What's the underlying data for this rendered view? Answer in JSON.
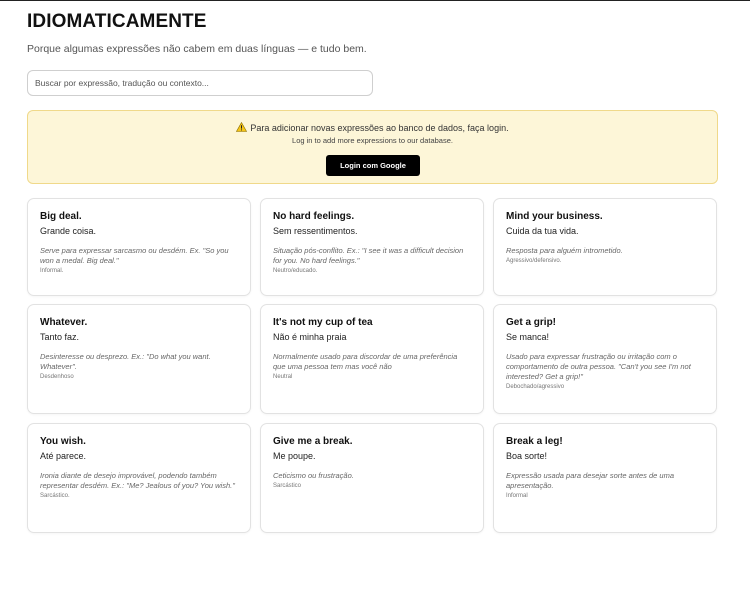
{
  "header": {
    "title": "IDIOMATICAMENTE",
    "subtitle": "Porque algumas expressões não cabem em duas línguas — e tudo bem."
  },
  "search": {
    "placeholder": "Buscar por expressão, tradução ou contexto..."
  },
  "notice": {
    "icon": "warning-icon",
    "line1": "Para adicionar novas expressões ao banco de dados, faça login.",
    "line2": "Log in to add more expressions to our database.",
    "login_label": "Login com Google",
    "bg_color": "#fdf6d8",
    "border_color": "#f0d98a"
  },
  "cards": [
    {
      "en": "Big deal.",
      "pt": "Grande coisa.",
      "desc": "Serve para expressar sarcasmo ou desdém. Ex. \"So you won a medal. Big deal.\"",
      "tone": "Informal."
    },
    {
      "en": "No hard feelings.",
      "pt": "Sem ressentimentos.",
      "desc": "Situação pós-conflito. Ex.: \"I see it was a difficult decision for you. No hard feelings.\"",
      "tone": "Neutro/educado."
    },
    {
      "en": "Mind your business.",
      "pt": "Cuida da tua vida.",
      "desc": "Resposta para alguém intrometido.",
      "tone": "Agressivo/defensivo."
    },
    {
      "en": "Whatever.",
      "pt": "Tanto faz.",
      "desc": "Desinteresse ou desprezo. Ex.: \"Do what you want. Whatever\".",
      "tone": "Desdenhoso"
    },
    {
      "en": "It's not my cup of tea",
      "pt": "Não é minha praia",
      "desc": "Normalmente usado para discordar de uma preferência que uma pessoa tem mas você não",
      "tone": "Neutral"
    },
    {
      "en": "Get a grip!",
      "pt": "Se manca!",
      "desc": "Usado para expressar frustração ou irritação com o comportamento de outra pessoa. \"Can't you see I'm not interested? Get a grip!\"",
      "tone": "Debochado/agressivo"
    },
    {
      "en": "You wish.",
      "pt": "Até parece.",
      "desc": "Ironia diante de desejo improvável, podendo também representar desdém. Ex.: \"Me? Jealous of you? You wish.\"",
      "tone": "Sarcástico."
    },
    {
      "en": "Give me a break.",
      "pt": "Me poupe.",
      "desc": "Ceticismo ou frustração.",
      "tone": "Sarcástico"
    },
    {
      "en": "Break a leg!",
      "pt": "Boa sorte!",
      "desc": "Expressão usada para desejar sorte antes de uma apresentação.",
      "tone": "Informal"
    }
  ]
}
